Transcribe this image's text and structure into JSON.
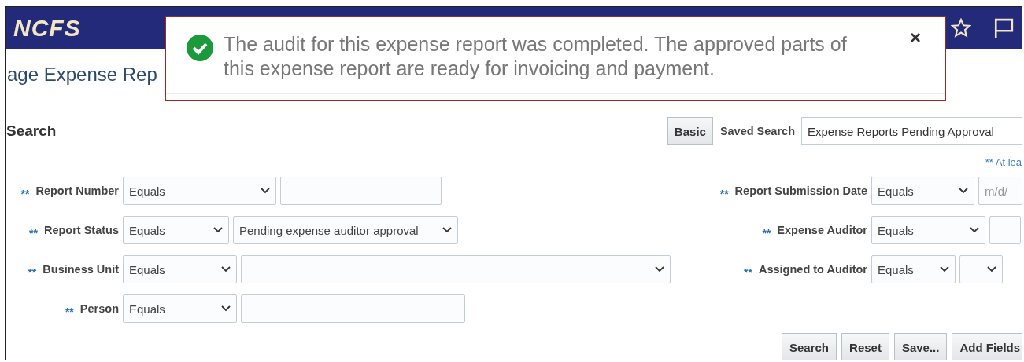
{
  "header": {
    "logo": "NCFS"
  },
  "toast": {
    "message": "The audit for this expense report was completed. The approved parts of this expense report are ready for invoicing and payment.",
    "close": "×"
  },
  "page_title": "age Expense Rep",
  "search": {
    "title": "Search",
    "basic_button": "Basic",
    "saved_search_label": "Saved Search",
    "saved_search_value": "Expense Reports Pending Approval",
    "note": "** At lea"
  },
  "left_fields": [
    {
      "required": "**",
      "label": "Report Number",
      "operator": "Equals",
      "kind": "text"
    },
    {
      "required": "**",
      "label": "Report Status",
      "operator": "Equals",
      "kind": "select",
      "value": "Pending expense auditor approval"
    },
    {
      "required": "**",
      "label": "Business Unit",
      "operator": "Equals",
      "kind": "select"
    },
    {
      "required": "**",
      "label": "Person",
      "operator": "Equals",
      "kind": "text"
    }
  ],
  "right_fields": [
    {
      "required": "**",
      "label": "Report Submission Date",
      "operator": "Equals",
      "kind": "text",
      "placeholder": "m/d/"
    },
    {
      "required": "**",
      "label": "Expense Auditor",
      "operator": "Equals",
      "kind": "text"
    },
    {
      "required": "**",
      "label": "Assigned to Auditor",
      "operator": "Equals",
      "kind": "select"
    }
  ],
  "buttons": [
    "Search",
    "Reset",
    "Save...",
    "Add Fields"
  ]
}
